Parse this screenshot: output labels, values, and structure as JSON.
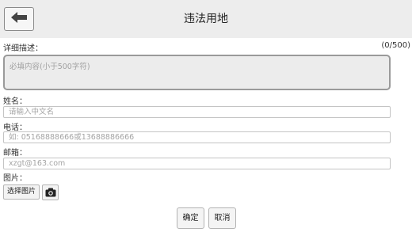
{
  "header": {
    "back_icon": "arrow-left-icon",
    "title": "违法用地"
  },
  "description": {
    "label": "详细描述：",
    "counter": "(0/500)",
    "placeholder": "必填内容(小于500字符)"
  },
  "name": {
    "label": "姓名：",
    "placeholder": "请输入中文名"
  },
  "phone": {
    "label": "电话：",
    "placeholder": "如: 05168888666或13688886666"
  },
  "email": {
    "label": "邮箱：",
    "placeholder": "xzgt@163.com"
  },
  "photo": {
    "label": "图片：",
    "select_label": "选择图片",
    "camera_icon": "camera-icon"
  },
  "actions": {
    "confirm_label": "确定",
    "cancel_label": "取消"
  }
}
